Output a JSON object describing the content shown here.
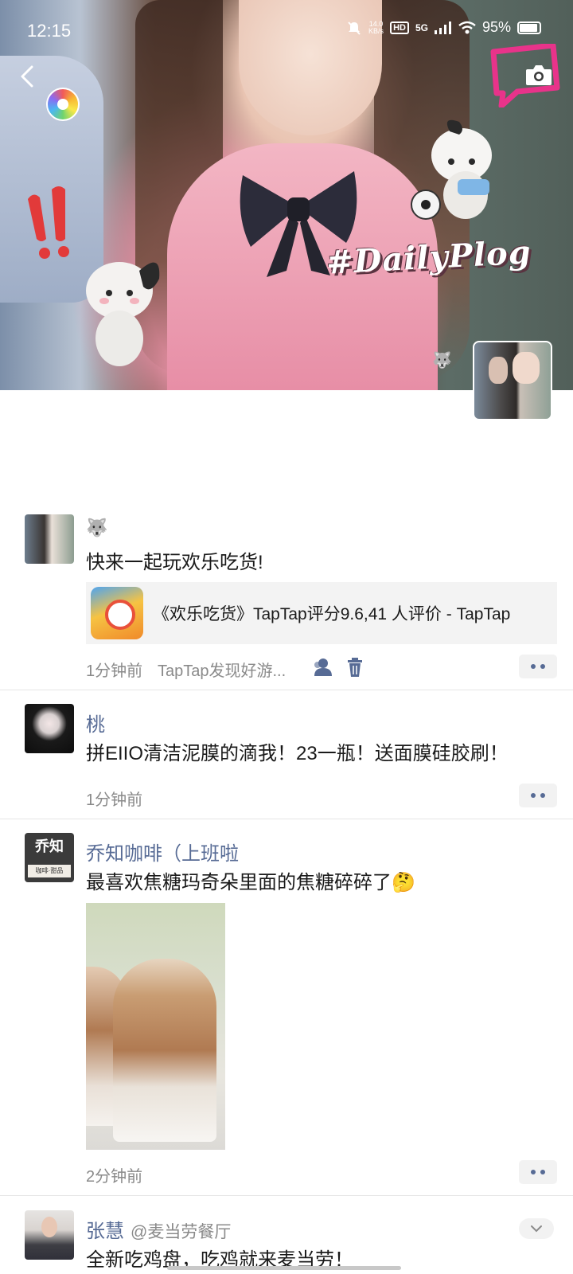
{
  "status_bar": {
    "time": "12:15",
    "net_speed_value": "14.0",
    "net_speed_unit": "KB/s",
    "hd_label": "HD",
    "network": "5G",
    "battery": "95%"
  },
  "cover": {
    "hashtag": "#DailyPlog"
  },
  "posts": [
    {
      "name": "",
      "name_icon": "wolf-emoji",
      "text": "快来一起玩欢乐吃货!",
      "link_title": "《欢乐吃货》TapTap评分9.6,41 人评价 - TapTap",
      "time": "1分钟前",
      "source": "TapTap发现好游..."
    },
    {
      "name": "桃",
      "text": "拼EIIO清洁泥膜的滴我！23一瓶！送面膜硅胶刷！",
      "time": "1分钟前"
    },
    {
      "name": "乔知咖啡（上班啦",
      "text": "最喜欢焦糖玛奇朵里面的焦糖碎碎了🤔",
      "avatar_text": "乔知",
      "avatar_subtext": "咖啡·甜品",
      "time": "2分钟前"
    },
    {
      "name": "张慧",
      "sub_name": "@麦当劳餐厅",
      "text": "全新吃鸡盘，吃鸡就来麦当劳！"
    }
  ],
  "colors": {
    "name_link": "#576b95",
    "time_gray": "#8a8a8a",
    "card_bg": "#f3f3f3"
  }
}
